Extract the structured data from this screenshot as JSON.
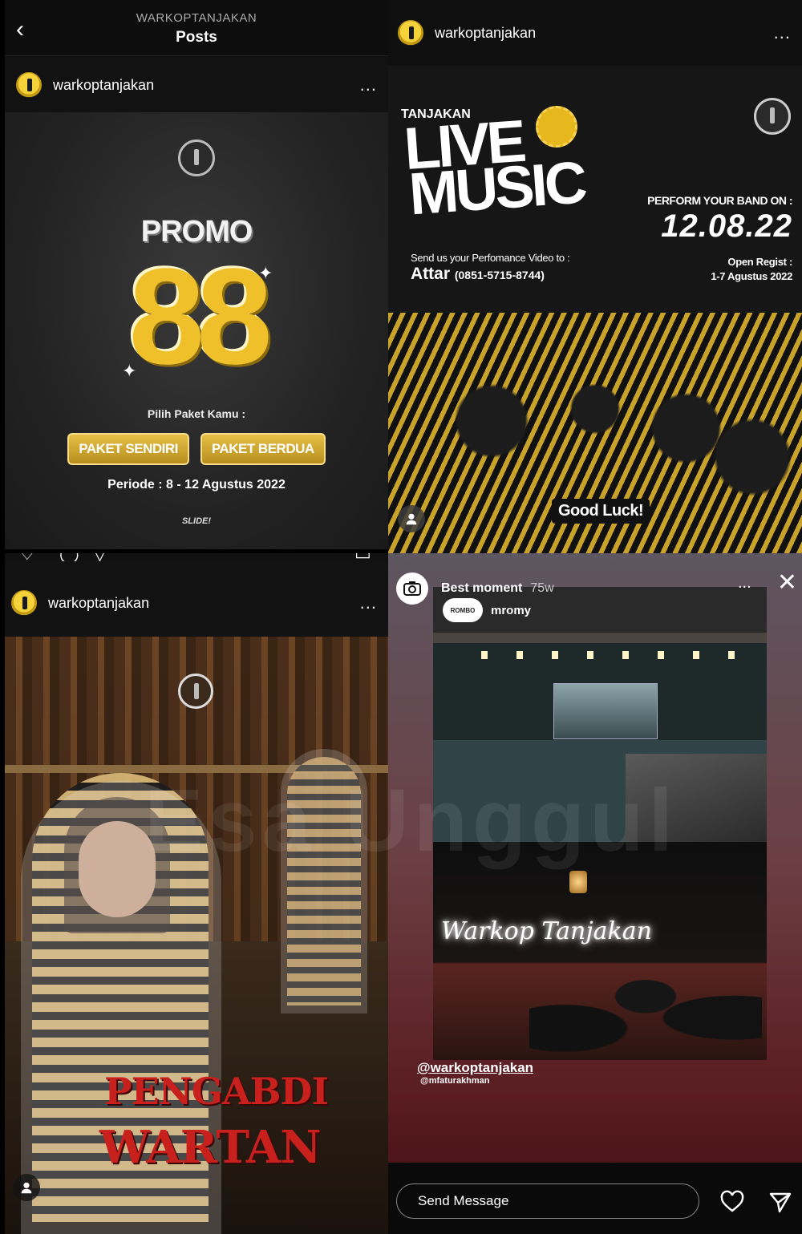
{
  "watermark": "Esa Unggul",
  "q1": {
    "back_icon": "chevron-left-icon",
    "account_label": "WARKOPTANJAKAN",
    "page_title": "Posts",
    "username": "warkoptanjakan",
    "more_icon": "more-dots-icon",
    "more_label": "...",
    "post": {
      "promo_word": "PROMO",
      "promo_number": "88",
      "pick_text": "Pilih Paket Kamu :",
      "packages": [
        "PAKET SENDIRI",
        "PAKET BERDUA"
      ],
      "period": "Periode : 8 - 12 Agustus 2022",
      "slide_hint": "SLIDE!"
    }
  },
  "q2": {
    "username": "warkoptanjakan",
    "more_label": "...",
    "post": {
      "brand": "TANJAKAN",
      "title_line1": "LIVE",
      "title_line2": "MUSIC",
      "perform_label": "PERFORM YOUR BAND ON :",
      "perform_date": "12.08.22",
      "send_label": "Send us your Perfomance Video to :",
      "contact_name": "Attar",
      "contact_phone": "(0851-5715-8744)",
      "open_regist_label": "Open Regist :",
      "open_regist_dates": "1-7 Agustus 2022",
      "good_luck": "Good Luck!"
    }
  },
  "q3": {
    "username": "warkoptanjakan",
    "more_label": "...",
    "post": {
      "title_line1": "PENGABDI",
      "title_line2": "WARTAN"
    }
  },
  "q4": {
    "story_name": "Best moment",
    "story_time": "75w",
    "more_label": "...",
    "close_label": "✕",
    "tag_brand": "ROMBO",
    "tag_user": "mromy",
    "neon_sign": "Warkop Tanjakan",
    "mention_main": "@warkoptanjakan",
    "mention_sub": "@mfaturakhman",
    "message_placeholder": "Send Message",
    "heart_icon": "heart-icon",
    "send_icon": "paper-plane-icon"
  }
}
